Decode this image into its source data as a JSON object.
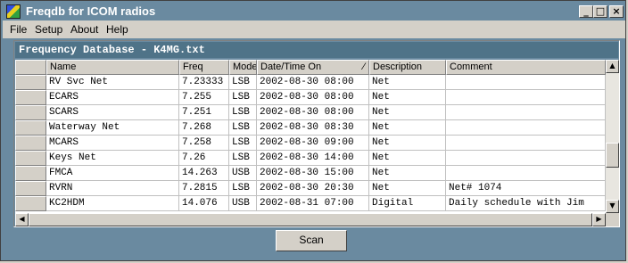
{
  "window": {
    "title": "Freqdb for ICOM radios",
    "min_label": "_",
    "max_label": "□",
    "close_label": "×"
  },
  "menu": [
    "File",
    "Setup",
    "About",
    "Help"
  ],
  "grid": {
    "caption": "Frequency Database - K4MG.txt",
    "columns": [
      "Name",
      "Freq",
      "Mode",
      "Date/Time On",
      "Description",
      "Comment"
    ],
    "sort_indicator": "⁄",
    "rows": [
      [
        "RV Svc Net",
        "7.23333",
        "LSB",
        "2002-08-30 08:00",
        "Net",
        ""
      ],
      [
        "ECARS",
        "7.255",
        "LSB",
        "2002-08-30 08:00",
        "Net",
        ""
      ],
      [
        "SCARS",
        "7.251",
        "LSB",
        "2002-08-30 08:00",
        "Net",
        ""
      ],
      [
        "Waterway Net",
        "7.268",
        "LSB",
        "2002-08-30 08:30",
        "Net",
        ""
      ],
      [
        "MCARS",
        "7.258",
        "LSB",
        "2002-08-30 09:00",
        "Net",
        ""
      ],
      [
        "Keys Net",
        "7.26",
        "LSB",
        "2002-08-30 14:00",
        "Net",
        ""
      ],
      [
        "FMCA",
        "14.263",
        "USB",
        "2002-08-30 15:00",
        "Net",
        ""
      ],
      [
        "RVRN",
        "7.2815",
        "LSB",
        "2002-08-30 20:30",
        "Net",
        "Net# 1074"
      ],
      [
        "KC2HDM",
        "14.076",
        "USB",
        "2002-08-31 07:00",
        "Digital",
        "Daily schedule with Jim"
      ]
    ]
  },
  "scrollbars": {
    "up": "▲",
    "down": "▼",
    "left": "◀",
    "right": "▶"
  },
  "scan_label": "Scan"
}
